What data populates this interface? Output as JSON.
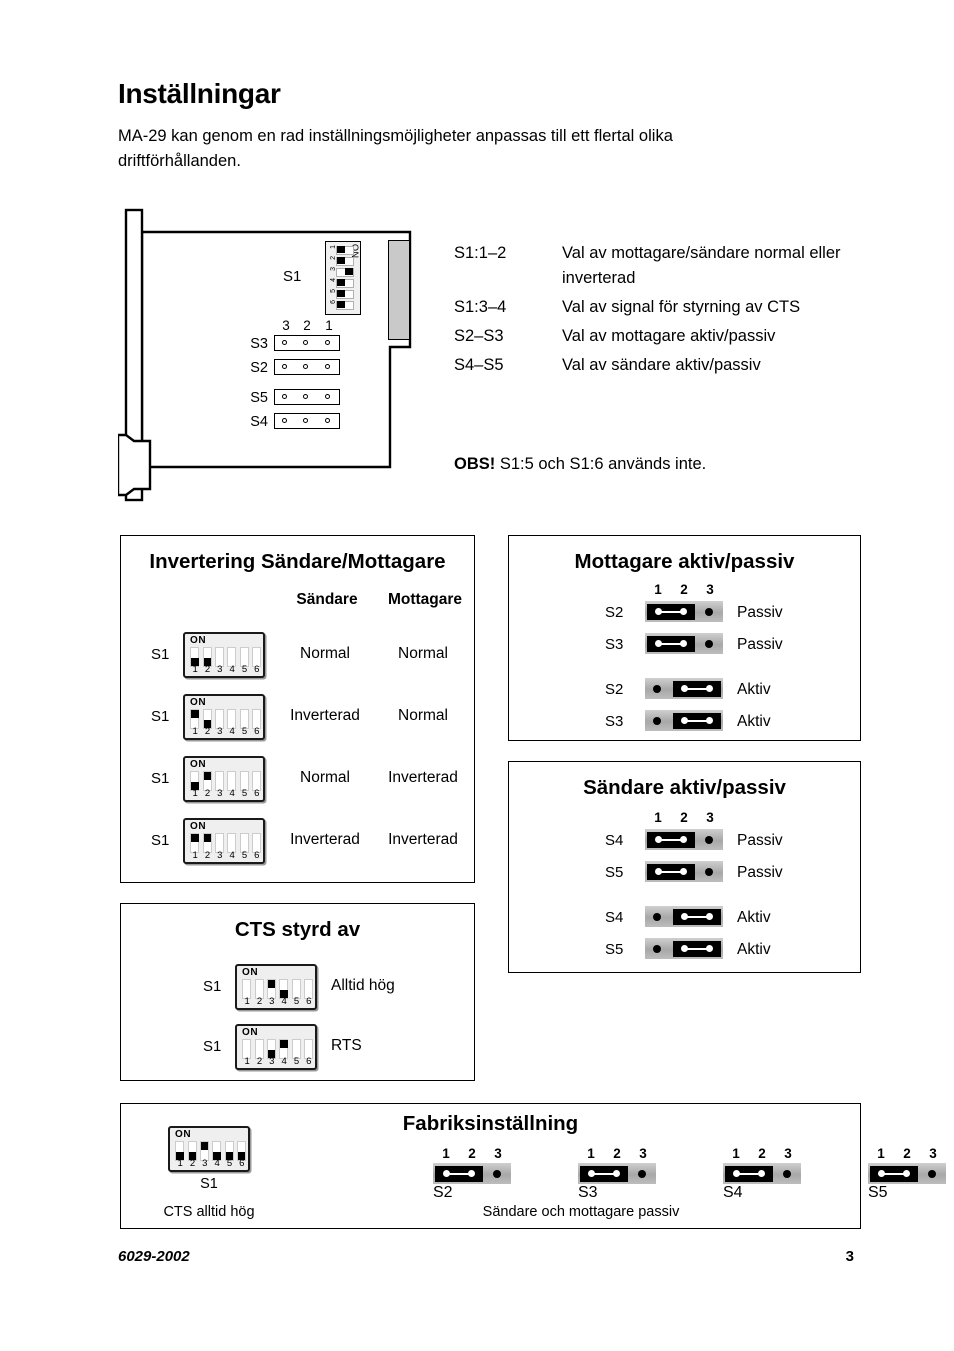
{
  "document": {
    "title": "Inställningar",
    "intro": "MA-29 kan genom en rad inställningsmöjligheter anpassas till ett flertal olika driftförhållanden.",
    "obs_prefix": "OBS!",
    "obs_text": "S1:5 och S1:6 används inte.",
    "footer_code": "6029-2002",
    "footer_page": "3"
  },
  "board": {
    "s1_label": "S1",
    "dip_on_label": "ON",
    "dip_numbers": [
      "1",
      "2",
      "3",
      "4",
      "5",
      "6"
    ],
    "dip_states": [
      "off",
      "off",
      "on",
      "off",
      "off",
      "off"
    ],
    "jumper_header": [
      "3",
      "2",
      "1"
    ],
    "jumpers": [
      {
        "name": "S3"
      },
      {
        "name": "S2"
      },
      {
        "name": "S5"
      },
      {
        "name": "S4"
      }
    ]
  },
  "legend": [
    {
      "code": "S1:1–2",
      "desc": "Val av mottagare/sändare normal eller inverterad"
    },
    {
      "code": "S1:3–4",
      "desc": "Val av signal för styrning av CTS"
    },
    {
      "code": "S2–S3",
      "desc": "Val av mottagare aktiv/passiv"
    },
    {
      "code": "S4–S5",
      "desc": "Val av sändare aktiv/passiv"
    }
  ],
  "panel_invertering": {
    "title": "Invertering Sändare/Mottagare",
    "col_sandare": "Sändare",
    "col_mottagare": "Mottagare",
    "dip_on_label": "ON",
    "dip_numbers": [
      "1",
      "2",
      "3",
      "4",
      "5",
      "6"
    ],
    "rows": [
      {
        "switch_name": "S1",
        "states": [
          "down",
          "down",
          "none",
          "none",
          "none",
          "none"
        ],
        "sandare": "Normal",
        "mottagare": "Normal"
      },
      {
        "switch_name": "S1",
        "states": [
          "up",
          "down",
          "none",
          "none",
          "none",
          "none"
        ],
        "sandare": "Inverterad",
        "mottagare": "Normal"
      },
      {
        "switch_name": "S1",
        "states": [
          "down",
          "up",
          "none",
          "none",
          "none",
          "none"
        ],
        "sandare": "Normal",
        "mottagare": "Inverterad"
      },
      {
        "switch_name": "S1",
        "states": [
          "up",
          "up",
          "none",
          "none",
          "none",
          "none"
        ],
        "sandare": "Inverterad",
        "mottagare": "Inverterad"
      }
    ]
  },
  "panel_cts": {
    "title": "CTS styrd av",
    "dip_on_label": "ON",
    "dip_numbers": [
      "1",
      "2",
      "3",
      "4",
      "5",
      "6"
    ],
    "rows": [
      {
        "switch_name": "S1",
        "states": [
          "none",
          "none",
          "up",
          "down",
          "none",
          "none"
        ],
        "value": "Alltid hög"
      },
      {
        "switch_name": "S1",
        "states": [
          "none",
          "none",
          "down",
          "up",
          "none",
          "none"
        ],
        "value": "RTS"
      }
    ]
  },
  "panel_mottagare": {
    "title": "Mottagare aktiv/passiv",
    "pin_header": [
      "1",
      "2",
      "3"
    ],
    "rows": [
      {
        "name": "S2",
        "cap": "pos12",
        "value": "Passiv"
      },
      {
        "name": "S3",
        "cap": "pos12",
        "value": "Passiv"
      },
      {
        "name": "S2",
        "cap": "pos23",
        "value": "Aktiv"
      },
      {
        "name": "S3",
        "cap": "pos23",
        "value": "Aktiv"
      }
    ]
  },
  "panel_sandare": {
    "title": "Sändare aktiv/passiv",
    "pin_header": [
      "1",
      "2",
      "3"
    ],
    "rows": [
      {
        "name": "S4",
        "cap": "pos12",
        "value": "Passiv"
      },
      {
        "name": "S5",
        "cap": "pos12",
        "value": "Passiv"
      },
      {
        "name": "S4",
        "cap": "pos23",
        "value": "Aktiv"
      },
      {
        "name": "S5",
        "cap": "pos23",
        "value": "Aktiv"
      }
    ]
  },
  "panel_factory": {
    "title": "Fabriksinställning",
    "dip_on_label": "ON",
    "dip_numbers": [
      "1",
      "2",
      "3",
      "4",
      "5",
      "6"
    ],
    "s1": {
      "label": "S1",
      "states": [
        "down",
        "down",
        "up",
        "down",
        "down",
        "down"
      ],
      "note": "CTS alltid hög"
    },
    "pin_header": [
      "1",
      "2",
      "3"
    ],
    "jumpers": [
      {
        "label": "S2",
        "cap": "pos12"
      },
      {
        "label": "S3",
        "cap": "pos12"
      },
      {
        "label": "S4",
        "cap": "pos12"
      },
      {
        "label": "S5",
        "cap": "pos12"
      }
    ],
    "note_rest": "Sändare och mottagare passiv"
  },
  "colors": {
    "ink": "#000000",
    "paper": "#ffffff",
    "connector_gray": "#c9c9c9",
    "dip_body": "#efefef",
    "jumper_body": "#b5b5b5"
  }
}
